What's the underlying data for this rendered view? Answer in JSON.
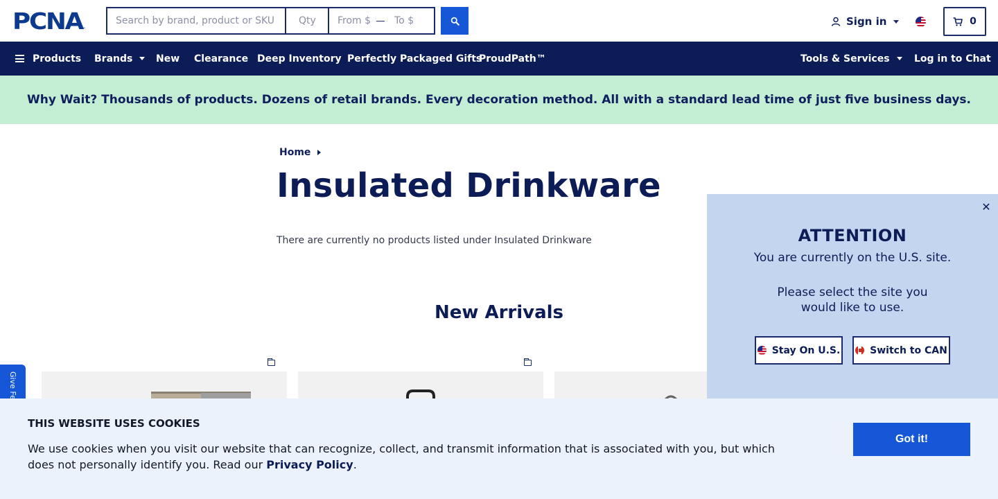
{
  "header": {
    "logo_text": "PCNA",
    "logo_tm": "™",
    "search_placeholder": "Search by brand, product or SKU",
    "qty_placeholder": "Qty",
    "price_from_placeholder": "From $",
    "price_to_placeholder": "To $",
    "signin_label": "Sign in",
    "cart_count": "0"
  },
  "nav": {
    "products": "Products",
    "brands": "Brands",
    "new": "New",
    "clearance": "Clearance",
    "deep_inventory": "Deep Inventory",
    "gifts": "Perfectly Packaged Gifts",
    "proudpath": "ProudPath™",
    "tools": "Tools & Services",
    "chat": "Log in to Chat"
  },
  "banner": {
    "text": "Why Wait? Thousands of products. Dozens of retail brands. Every decoration method. All with a standard lead time of just five business days."
  },
  "page": {
    "breadcrumb_home": "Home",
    "title": "Insulated Drinkware",
    "empty_message": "There are currently no products listed under Insulated Drinkware",
    "new_arrivals_title": "New Arrivals"
  },
  "feedback": {
    "label": "Give Feedback"
  },
  "region_modal": {
    "close_glyph": "✕",
    "title": "ATTENTION",
    "subtitle": "You are currently on the U.S. site.",
    "prompt": "Please select the site you would like to use.",
    "stay_label": "Stay On U.S.",
    "switch_label": "Switch to CAN"
  },
  "cookies": {
    "title": "THIS WEBSITE USES COOKIES",
    "text": "We use cookies when you visit our website that can recognize, collect, and transmit information that is associated with you, but which does not personally identify you. Read our ",
    "link_label": "Privacy Policy",
    "text_end": ".",
    "button_label": "Got it!"
  },
  "colors": {
    "brand_navy": "#0b1c56",
    "accent_blue": "#1557d6",
    "banner_green": "#c3eed4",
    "modal_blue": "#c4d6ef",
    "cookie_bg": "#ebf2fb"
  }
}
